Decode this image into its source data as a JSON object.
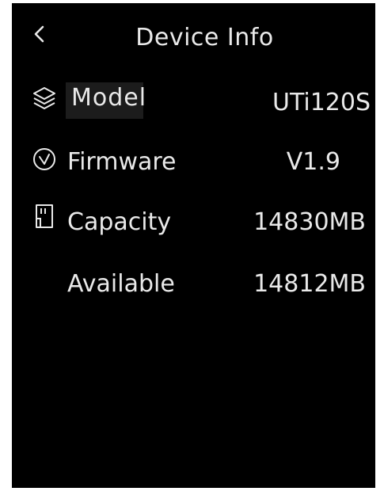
{
  "header": {
    "title": "Device Info"
  },
  "rows": [
    {
      "label": "Model",
      "value": "UTi120S",
      "icon": "layers-icon"
    },
    {
      "label": "Firmware",
      "value": "V1.9",
      "icon": "check-circle-icon"
    },
    {
      "label": "Capacity",
      "value": "14830MB",
      "icon": "sd-card-icon"
    },
    {
      "label": "Available",
      "value": "14812MB"
    }
  ]
}
